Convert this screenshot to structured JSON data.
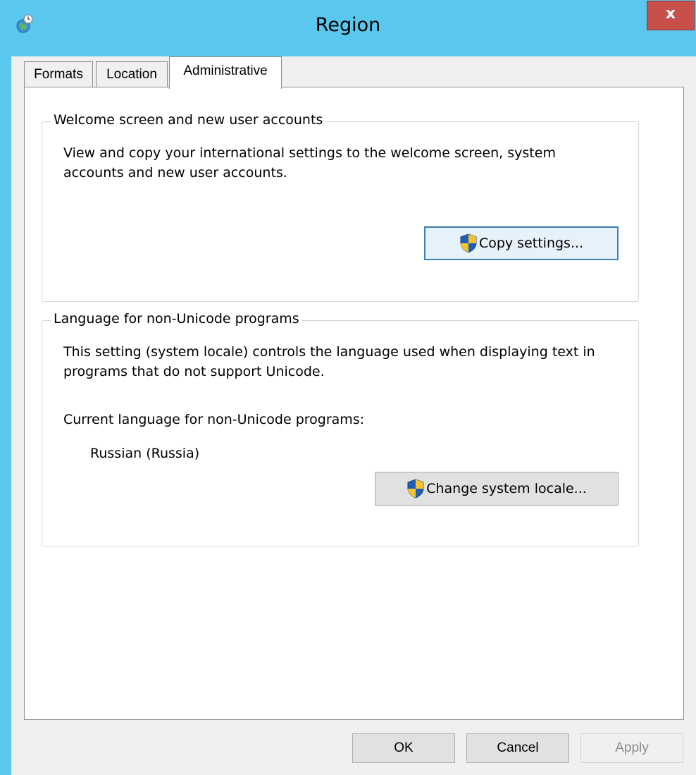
{
  "window": {
    "title": "Region",
    "close_label": "x",
    "icon": "globe-clock-icon",
    "title_bar_color": "#5ac8ee"
  },
  "tabs": [
    {
      "label": "Formats",
      "selected": false
    },
    {
      "label": "Location",
      "selected": false
    },
    {
      "label": "Administrative",
      "selected": true
    }
  ],
  "welcome_group": {
    "legend": "Welcome screen and new user accounts",
    "description": "View and copy your international settings to the welcome screen, system accounts and new user accounts.",
    "button_label": "Copy settings...",
    "button_icon": "uac-shield-icon"
  },
  "language_group": {
    "legend": "Language for non-Unicode programs",
    "description": "This setting (system locale) controls the language used when displaying text in programs that do not support Unicode.",
    "current_label": "Current language for non-Unicode programs:",
    "current_value": "Russian (Russia)",
    "button_label": "Change system locale...",
    "button_icon": "uac-shield-icon"
  },
  "footer": {
    "ok_label": "OK",
    "cancel_label": "Cancel",
    "apply_label": "Apply",
    "apply_enabled": false
  }
}
